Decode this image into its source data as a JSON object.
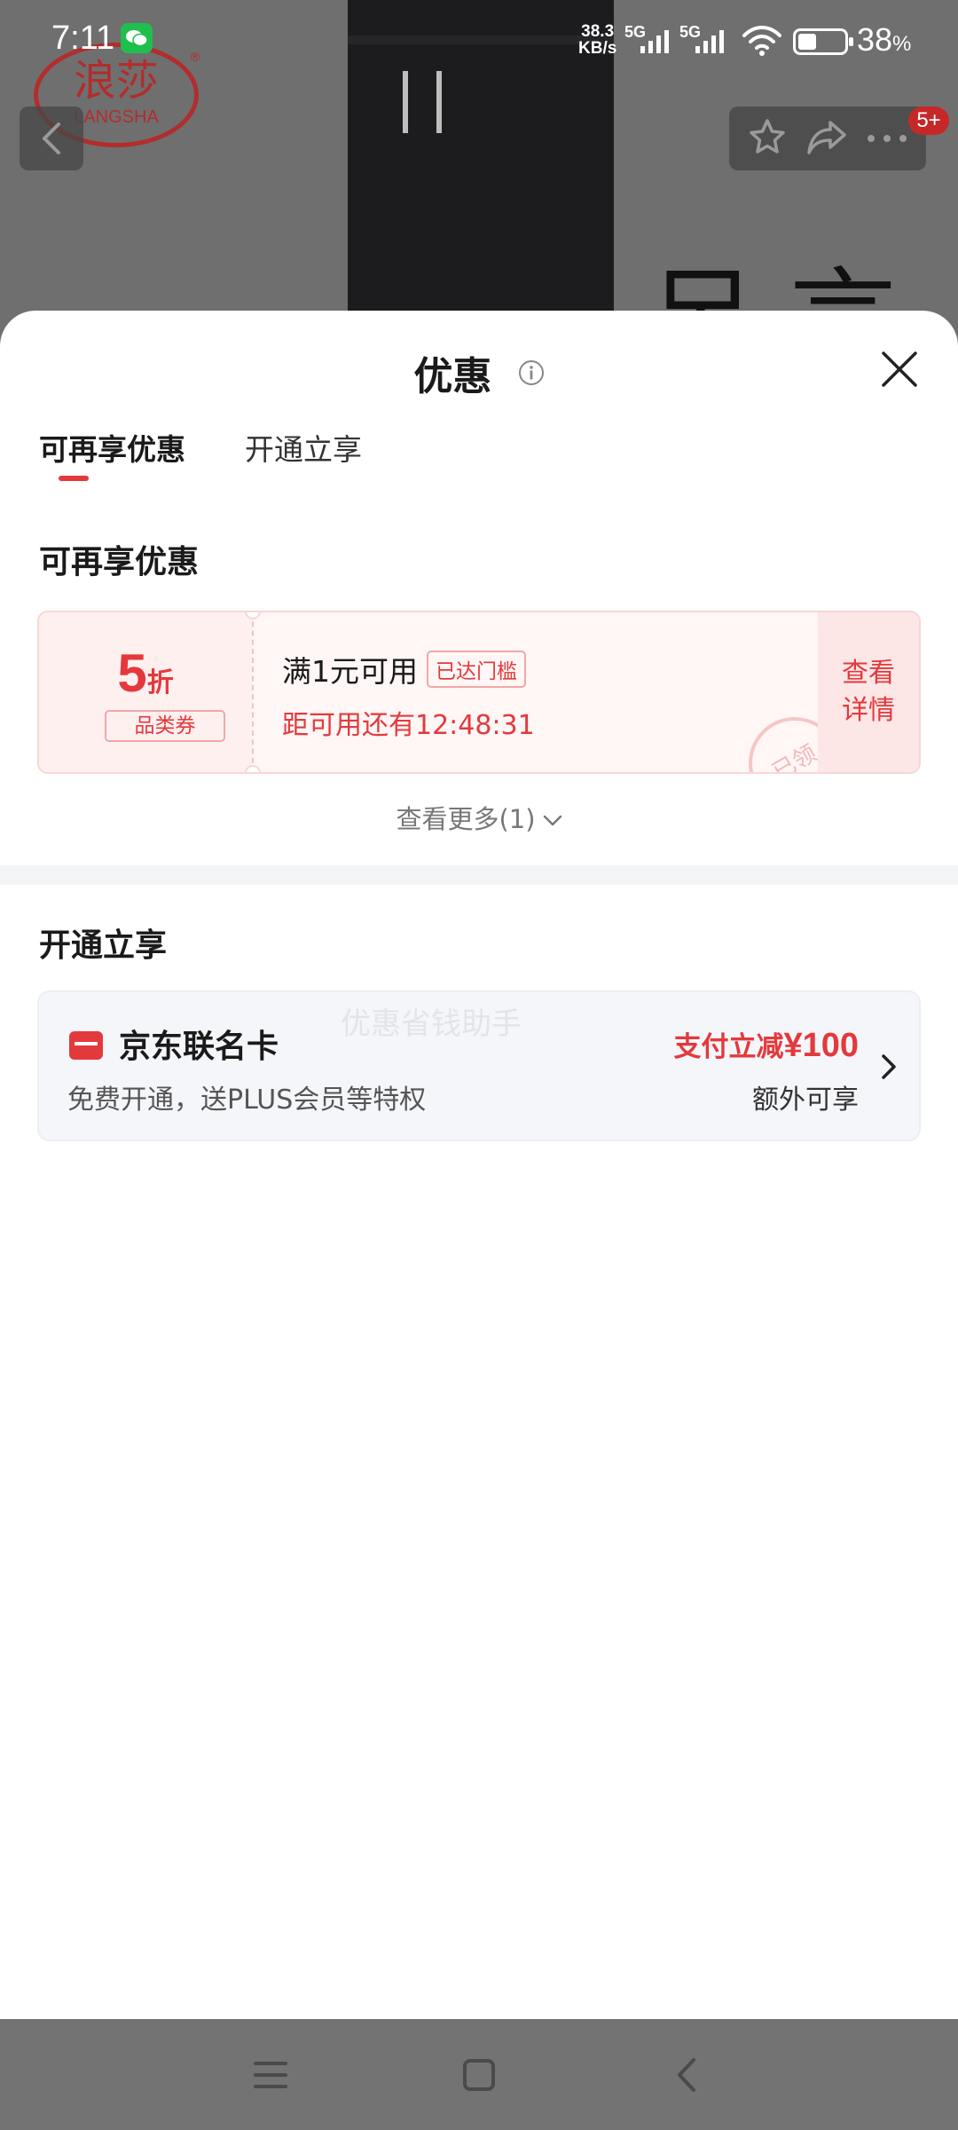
{
  "status_bar": {
    "time": "7:11",
    "net_speed_value": "38.3",
    "net_speed_unit": "KB/s",
    "network_1": "5G",
    "network_2": "5G",
    "battery_value": "38",
    "battery_unit": "%",
    "battery_level": 0.38
  },
  "background": {
    "brand_cn": "浪莎",
    "brand_en": "LANGSHA",
    "brand_mark": "®",
    "partial_char": "另 言",
    "message_badge": "5+"
  },
  "sheet": {
    "title": "优惠",
    "tabs": [
      {
        "label": "可再享优惠",
        "active": true
      },
      {
        "label": "开通立享",
        "active": false
      }
    ],
    "section1_title": "可再享优惠",
    "coupon": {
      "value": "5",
      "unit": "折",
      "type": "品类券",
      "condition": "满1元可用",
      "badge": "已达门槛",
      "countdown": "距可用还有12:48:31",
      "detail_label": "查看详情",
      "stamp": "已领"
    },
    "see_more": "查看更多(1)",
    "section2_title": "开通立享",
    "card": {
      "name": "京东联名卡",
      "description": "免费开通，送PLUS会员等特权",
      "watermark": "优惠省钱助手",
      "promo_prefix": "支付立减",
      "promo_amount": "¥100",
      "extra": "额外可享"
    }
  },
  "colors": {
    "accent": "#e4393c",
    "overlay": "#6f6f6f",
    "card_bg": "#f5f6fa"
  },
  "icons": [
    "back-icon",
    "star-icon",
    "share-icon",
    "more-icon",
    "info-icon",
    "close-icon",
    "chevron-down-icon",
    "bank-card-icon",
    "chevron-right-icon",
    "menu-icon",
    "home-icon",
    "nav-back-icon",
    "wechat-icon",
    "wifi-icon",
    "signal-icon",
    "battery-icon"
  ]
}
